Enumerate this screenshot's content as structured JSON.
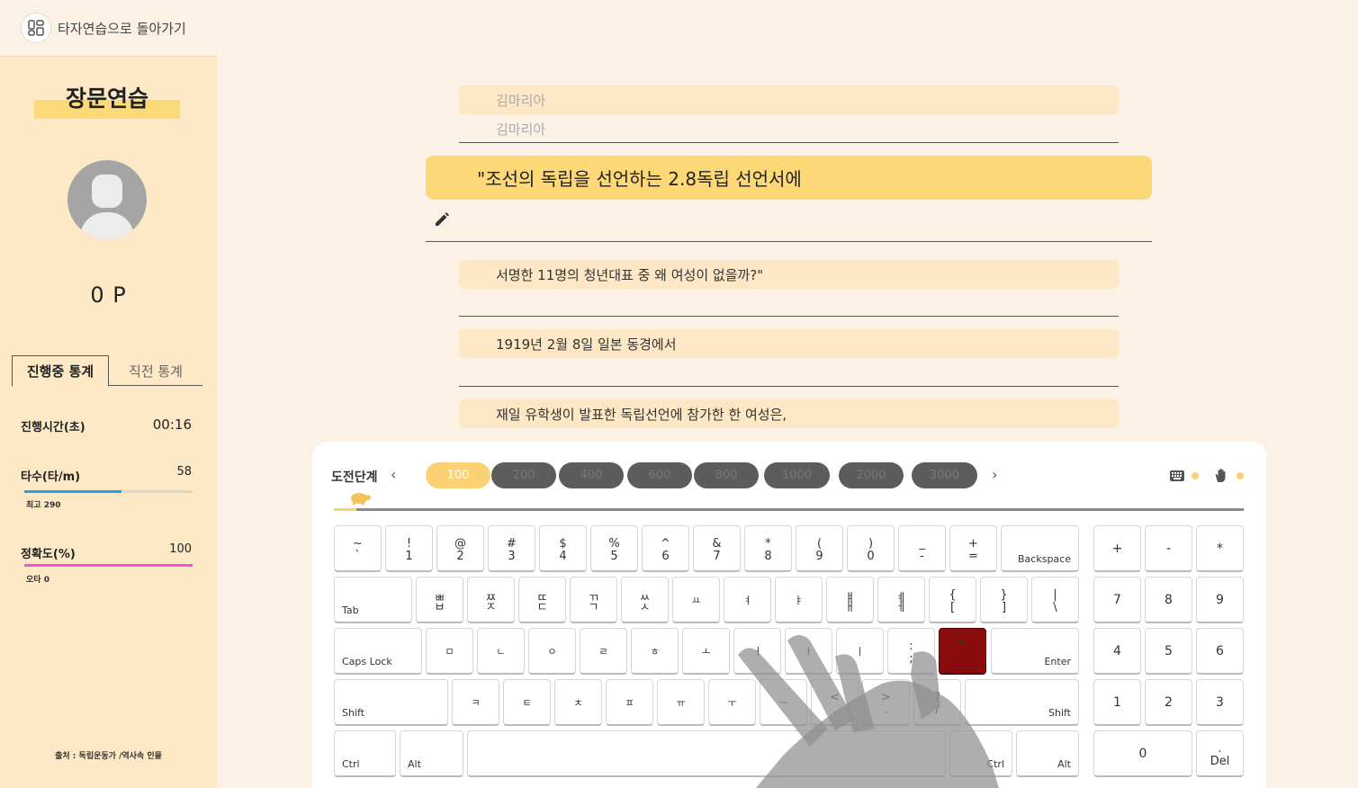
{
  "sidebar": {
    "back_label": "타자연습으로 돌아가기",
    "title": "장문연습",
    "points": "0 P",
    "tabs": [
      "진행중 통계",
      "직전 통계"
    ],
    "stats": {
      "time": {
        "label": "진행시간(초)",
        "value": "00:16"
      },
      "speed": {
        "label": "타수(타/m)",
        "value": "58",
        "best": "최고 290",
        "fill_fraction": 0.58,
        "color": "#1fa3ee"
      },
      "accuracy": {
        "label": "정확도(%)",
        "value": "100",
        "typos": "오타 0",
        "fill_fraction": 1.0,
        "color": "#ee55e0"
      }
    },
    "source": "출처 : 독립운동가 /역사속 인물"
  },
  "text": {
    "prev_line": "김마리아",
    "prev_typed": "김마리아",
    "current_line": "\"조선의 독립을 선언하는 2.8독립 선언서에",
    "upcoming": [
      "서명한 11명의 청년대표 중 왜 여성이 없을까?\"",
      "1919년 2월 8일 일본 동경에서",
      "재일 유학생이 발표한 독립선언에 참가한 한 여성은,"
    ]
  },
  "keyboard_panel": {
    "stage_label": "도전단계",
    "stages": [
      "100",
      "200",
      "400",
      "600",
      "800",
      "1000",
      "2000",
      "3000"
    ],
    "active_stage": "100",
    "progress_fraction": 0.025,
    "icons": [
      "keyboard-icon",
      "hand-icon"
    ]
  },
  "keys": {
    "row1": [
      {
        "t": "~",
        "b": "`"
      },
      {
        "t": "!",
        "b": "1"
      },
      {
        "t": "@",
        "b": "2"
      },
      {
        "t": "#",
        "b": "3"
      },
      {
        "t": "$",
        "b": "4"
      },
      {
        "t": "%",
        "b": "5"
      },
      {
        "t": "^",
        "b": "6"
      },
      {
        "t": "&",
        "b": "7"
      },
      {
        "t": "*",
        "b": "8"
      },
      {
        "t": "(",
        "b": "9"
      },
      {
        "t": ")",
        "b": "0"
      },
      {
        "t": "_",
        "b": "-"
      },
      {
        "t": "+",
        "b": "="
      }
    ],
    "backspace": "Backspace",
    "tab": "Tab",
    "row2": [
      {
        "t": "ㅃ",
        "b": "ㅂ"
      },
      {
        "t": "ㅉ",
        "b": "ㅈ"
      },
      {
        "t": "ㄸ",
        "b": "ㄷ"
      },
      {
        "t": "ㄲ",
        "b": "ㄱ"
      },
      {
        "t": "ㅆ",
        "b": "ㅅ"
      },
      {
        "c": "ㅛ"
      },
      {
        "c": "ㅕ"
      },
      {
        "c": "ㅑ"
      },
      {
        "t": "ㅒ",
        "b": "ㅐ"
      },
      {
        "t": "ㅖ",
        "b": "ㅔ"
      },
      {
        "t": "{",
        "b": "["
      },
      {
        "t": "}",
        "b": "]"
      },
      {
        "t": "|",
        "b": "\\"
      }
    ],
    "capslock": "Caps Lock",
    "row3": [
      {
        "c": "ㅁ"
      },
      {
        "c": "ㄴ"
      },
      {
        "c": "ㅇ"
      },
      {
        "c": "ㄹ"
      },
      {
        "c": "ㅎ"
      },
      {
        "c": "ㅗ"
      },
      {
        "c": "ㅓ"
      },
      {
        "c": "ㅏ"
      },
      {
        "c": "ㅣ"
      },
      {
        "t": ":",
        "b": ";"
      },
      {
        "t": "\"",
        "b": "'"
      }
    ],
    "enter": "Enter",
    "shift": "Shift",
    "row4": [
      {
        "c": "ㅋ"
      },
      {
        "c": "ㅌ"
      },
      {
        "c": "ㅊ"
      },
      {
        "c": "ㅍ"
      },
      {
        "c": "ㅠ"
      },
      {
        "c": "ㅜ"
      },
      {
        "c": "ㅡ"
      },
      {
        "t": "<",
        "b": ","
      },
      {
        "t": ">",
        "b": "."
      },
      {
        "t": "?",
        "b": "/"
      }
    ],
    "ctrl": "Ctrl",
    "alt": "Alt",
    "numpad": {
      "r1": [
        "+",
        "-",
        "*"
      ],
      "r2": [
        "7",
        "8",
        "9"
      ],
      "r3": [
        "4",
        "5",
        "6"
      ],
      "r4": [
        "1",
        "2",
        "3"
      ],
      "zero": "0",
      "del_top": ".",
      "del": "Del"
    },
    "target_key_color": "#8a0d0d"
  }
}
